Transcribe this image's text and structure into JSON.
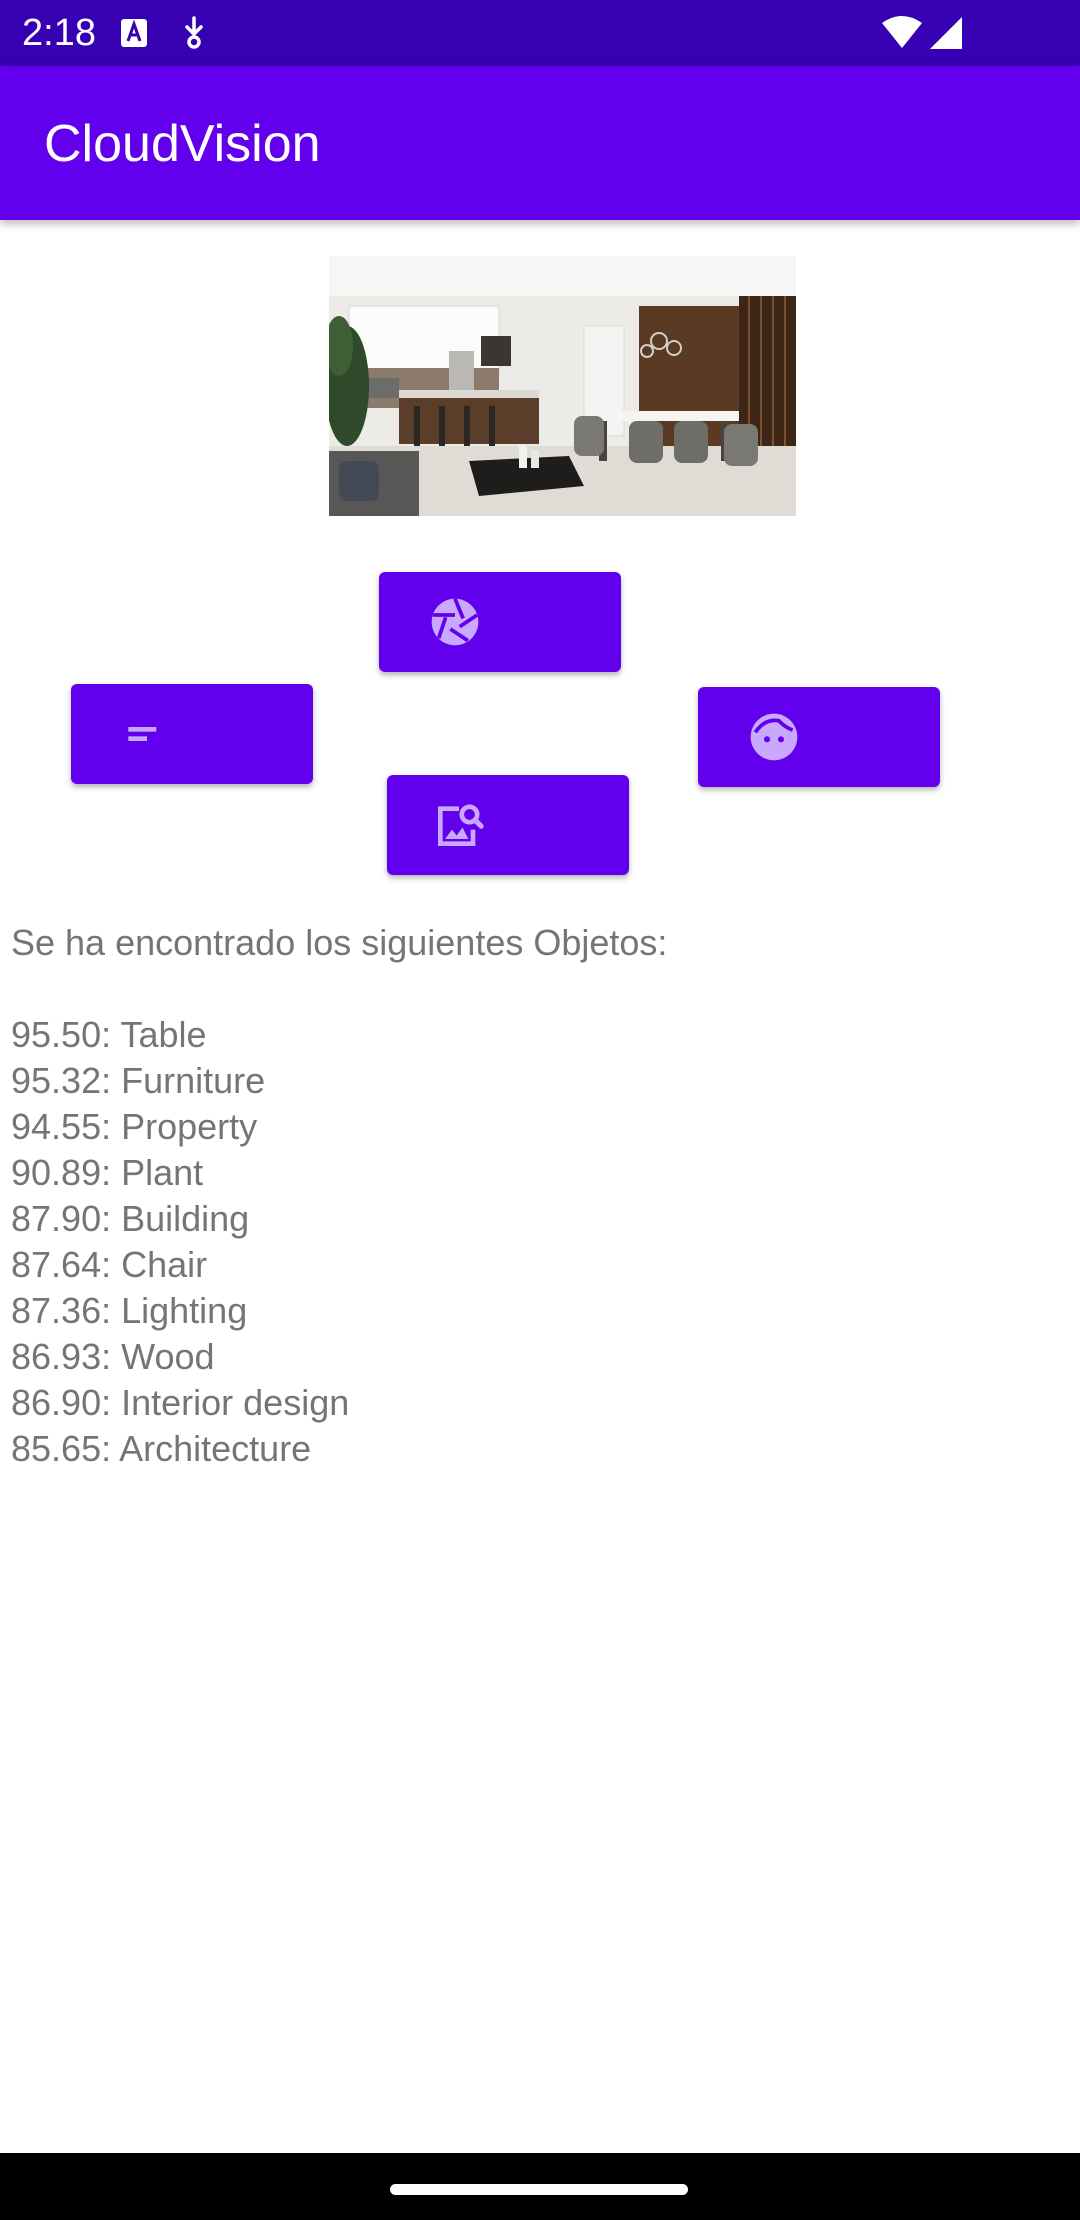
{
  "status_bar": {
    "time": "2:18",
    "icons": [
      "keyboard-notification-icon",
      "download-notification-icon",
      "wifi-icon",
      "cell-signal-icon"
    ]
  },
  "app_bar": {
    "title": "CloudVision"
  },
  "buttons": [
    {
      "name": "camera-button",
      "icon": "camera-shutter-icon"
    },
    {
      "name": "text-button",
      "icon": "short-text-icon"
    },
    {
      "name": "face-button",
      "icon": "face-icon"
    },
    {
      "name": "image-search-button",
      "icon": "image-search-icon"
    }
  ],
  "results": {
    "header": "Se ha encontrado los siguientes Objetos:",
    "items": [
      {
        "score": "95.50",
        "label": "Table"
      },
      {
        "score": "95.32",
        "label": "Furniture"
      },
      {
        "score": "94.55",
        "label": "Property"
      },
      {
        "score": "90.89",
        "label": "Plant"
      },
      {
        "score": "87.90",
        "label": "Building"
      },
      {
        "score": "87.64",
        "label": "Chair"
      },
      {
        "score": "87.36",
        "label": "Lighting"
      },
      {
        "score": "86.93",
        "label": "Wood"
      },
      {
        "score": "86.90",
        "label": "Interior design"
      },
      {
        "score": "85.65",
        "label": "Architecture"
      }
    ]
  },
  "colors": {
    "status_bar": "#3700b3",
    "primary": "#6200ee",
    "button_icon": "#c9a8ff",
    "result_text": "#757575",
    "nav_bar": "#000000"
  }
}
